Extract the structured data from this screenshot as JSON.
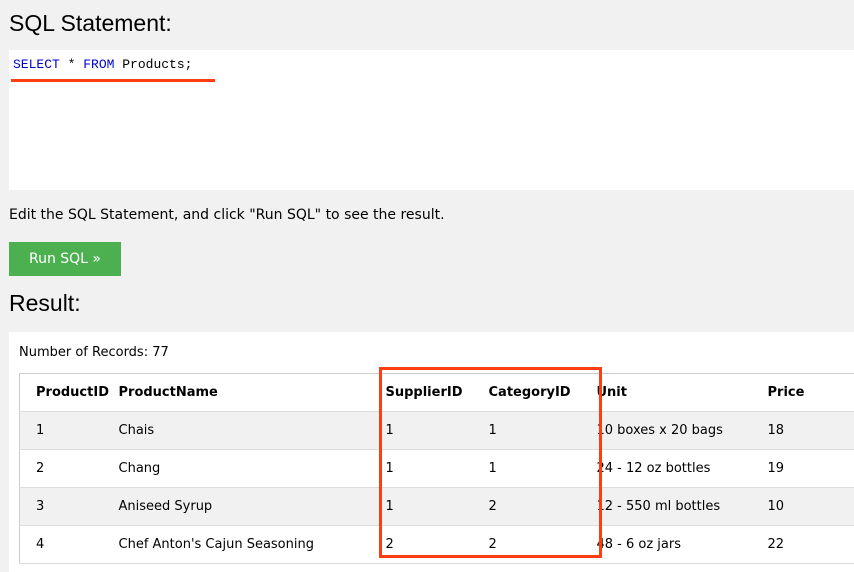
{
  "sql_title": "SQL Statement:",
  "code": {
    "kw1": "SELECT",
    "star": " * ",
    "kw2": "FROM",
    "rest": " Products;"
  },
  "instruction": "Edit the SQL Statement, and click \"Run SQL\" to see the result.",
  "run_button": "Run SQL »",
  "result_title": "Result:",
  "record_count": "Number of Records: 77",
  "columns": [
    "ProductID",
    "ProductName",
    "SupplierID",
    "CategoryID",
    "Unit",
    "Price"
  ],
  "rows": [
    [
      "1",
      "Chais",
      "1",
      "1",
      "10 boxes x 20 bags",
      "18"
    ],
    [
      "2",
      "Chang",
      "1",
      "1",
      "24 - 12 oz bottles",
      "19"
    ],
    [
      "3",
      "Aniseed Syrup",
      "1",
      "2",
      "12 - 550 ml bottles",
      "10"
    ],
    [
      "4",
      "Chef Anton's Cajun Seasoning",
      "2",
      "2",
      "48 - 6 oz jars",
      "22"
    ]
  ]
}
